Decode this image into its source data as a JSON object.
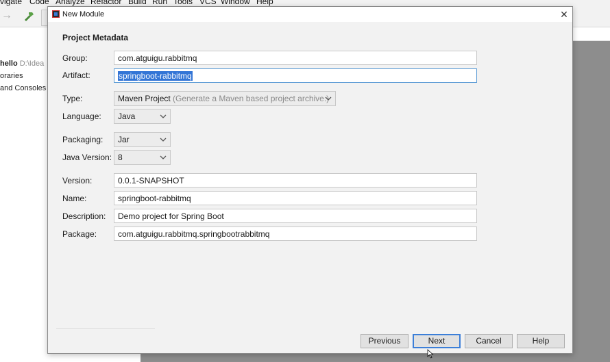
{
  "ide": {
    "menu": [
      "vigate",
      "Code",
      "Analyze",
      "Refactor",
      "Build",
      "Run",
      "Tools",
      "VCS",
      "Window",
      "Help"
    ],
    "project_tree": {
      "root_name": "hello",
      "root_path": "D:\\Idea",
      "items": [
        "oraries",
        "and Consoles"
      ]
    }
  },
  "dialog": {
    "title": "New Module",
    "section_title": "Project Metadata",
    "fields": {
      "group": {
        "label": "Group:",
        "value": "com.atguigu.rabbitmq"
      },
      "artifact": {
        "label": "Artifact:",
        "value": "springboot-rabbitmq"
      },
      "type": {
        "label": "Type:",
        "value": "Maven Project",
        "hint": "(Generate a Maven based project archive.)"
      },
      "language": {
        "label": "Language:",
        "value": "Java"
      },
      "packaging": {
        "label": "Packaging:",
        "value": "Jar"
      },
      "java_version": {
        "label": "Java Version:",
        "value": "8"
      },
      "version": {
        "label": "Version:",
        "value": "0.0.1-SNAPSHOT"
      },
      "name": {
        "label": "Name:",
        "value": "springboot-rabbitmq"
      },
      "description": {
        "label": "Description:",
        "value": "Demo project for Spring Boot"
      },
      "package": {
        "label": "Package:",
        "value": "com.atguigu.rabbitmq.springbootrabbitmq"
      }
    },
    "buttons": {
      "previous": "Previous",
      "next": "Next",
      "cancel": "Cancel",
      "help": "Help"
    }
  },
  "colors": {
    "accent": "#3c7fd8",
    "selection": "#3375d6",
    "dialog_bg": "#f2f2f2"
  },
  "icons": [
    "app-logo-icon",
    "close-icon",
    "back-arrow-icon",
    "hammer-icon",
    "chevron-down-icon",
    "mouse-cursor-icon"
  ]
}
